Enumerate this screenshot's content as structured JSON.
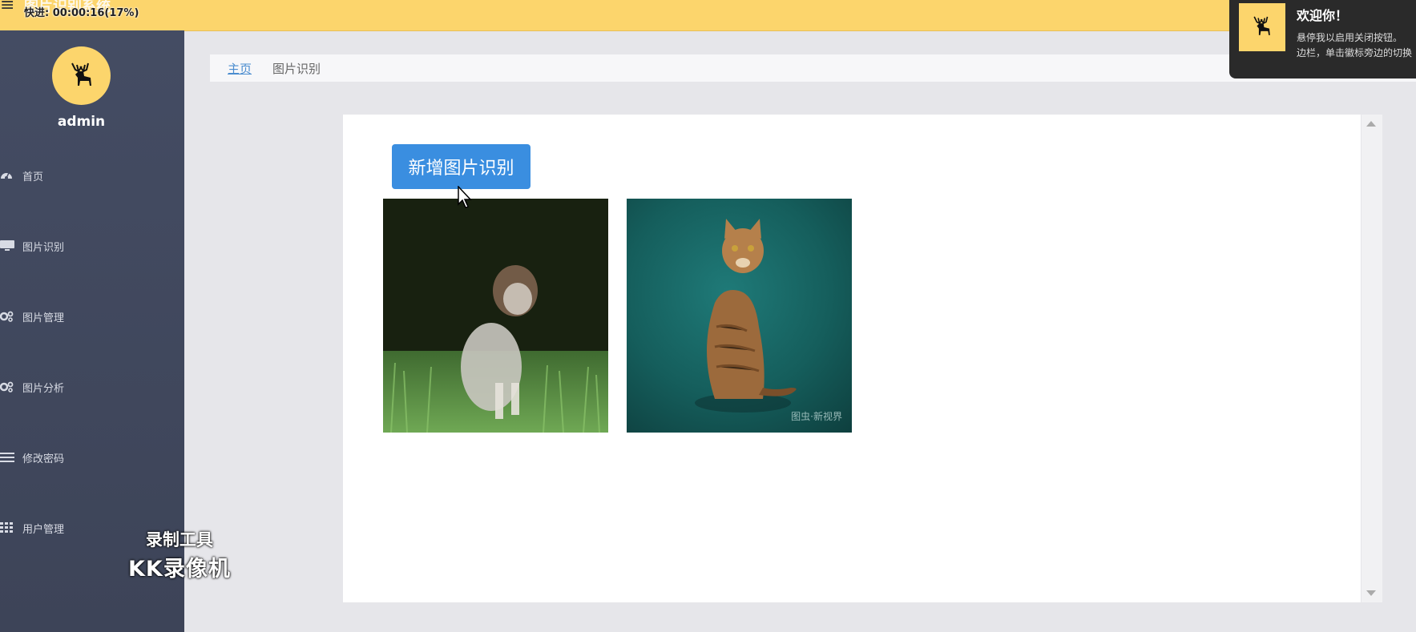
{
  "topbar": {
    "menu_icon": "hamburger-icon",
    "app_title": "图片识别系统",
    "recording_status": "快进: 00:00:16(17%)"
  },
  "sidebar": {
    "username": "admin",
    "avatar_icon": "deer-icon",
    "items": [
      {
        "label": "首页",
        "icon": "dashboard-icon"
      },
      {
        "label": "图片识别",
        "icon": "monitor-icon"
      },
      {
        "label": "图片管理",
        "icon": "gears-icon"
      },
      {
        "label": "图片分析",
        "icon": "gears-icon"
      },
      {
        "label": "修改密码",
        "icon": "list-icon"
      },
      {
        "label": "用户管理",
        "icon": "grid-icon"
      }
    ]
  },
  "breadcrumb": {
    "home": "主页",
    "current": "图片识别"
  },
  "main": {
    "add_button": "新增图片识别",
    "images": [
      {
        "alt": "dog",
        "watermark": ""
      },
      {
        "alt": "cat",
        "watermark": "图虫·新视界"
      }
    ]
  },
  "toast": {
    "title": "欢迎你！",
    "line1": "悬停我以启用关闭按钮。",
    "line2": "边栏，单击徽标旁边的切换"
  },
  "overlay": {
    "watermark_line1": "录制工具",
    "watermark_line2": "KK录像机"
  },
  "colors": {
    "topbar": "#fcd56c",
    "sidebar": "#444c63",
    "primary_button": "#3a8ee0",
    "link": "#4a8ccf"
  }
}
